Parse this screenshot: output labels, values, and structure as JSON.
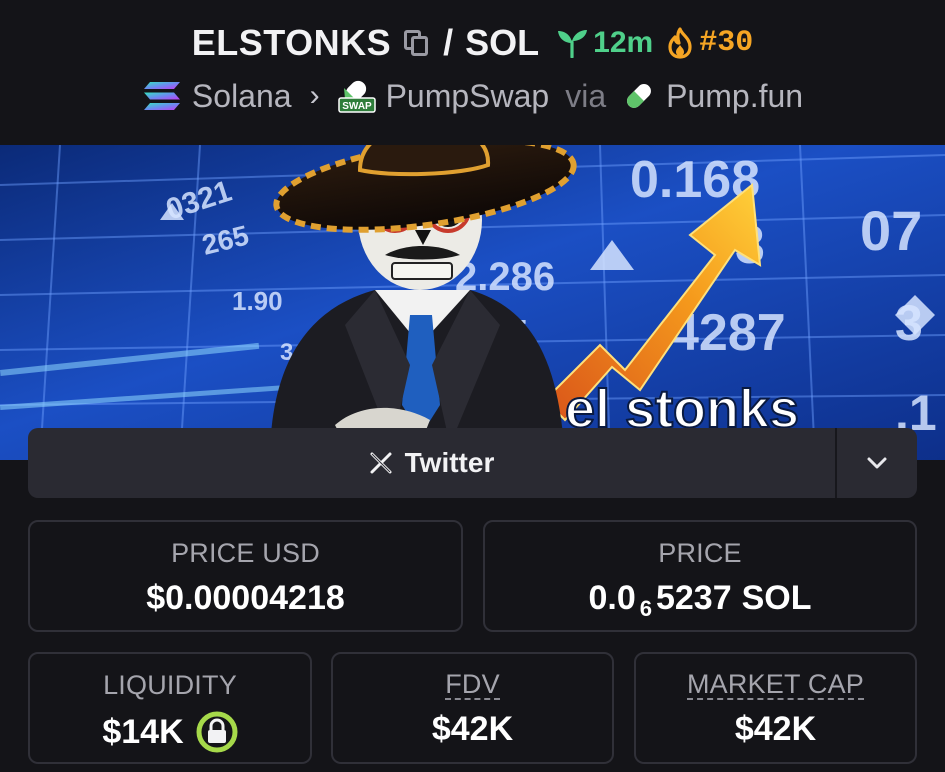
{
  "pair": {
    "base": "ELSTONKS",
    "separator": "/",
    "quote": "SOL",
    "age": "12m",
    "rank": "#30"
  },
  "route": {
    "chain": "Solana",
    "dex": "PumpSwap",
    "via": "via",
    "launchpad": "Pump.fun",
    "dex_badge": "SWAP"
  },
  "banner": {
    "caption": "el stonks",
    "ticker_values": [
      "0.168",
      "07",
      "3",
      "2.286",
      "4287",
      "115",
      "3",
      ".1",
      "0321",
      "1.90",
      "3",
      "265"
    ]
  },
  "social": {
    "twitter_label": "Twitter"
  },
  "stats": {
    "price_usd_label": "PRICE USD",
    "price_usd_value": "$0.00004218",
    "price_label": "PRICE",
    "price_sol_prefix": "0.0",
    "price_sol_subscript": "6",
    "price_sol_digits": "5237",
    "price_sol_unit": "SOL",
    "liquidity_label": "LIQUIDITY",
    "liquidity_value": "$14K",
    "fdv_label": "FDV",
    "fdv_value": "$42K",
    "mcap_label": "MARKET CAP",
    "mcap_value": "$42K"
  },
  "colors": {
    "background": "#141418",
    "age_green": "#4fd08a",
    "rank_orange": "#f5a524",
    "lock_green": "#a6d94a"
  },
  "icons": [
    "copy-icon",
    "sprout-icon",
    "flame-icon",
    "solana-icon",
    "pumpswap-icon",
    "pill-icon",
    "x-icon",
    "chevron-down-icon",
    "lock-icon"
  ]
}
